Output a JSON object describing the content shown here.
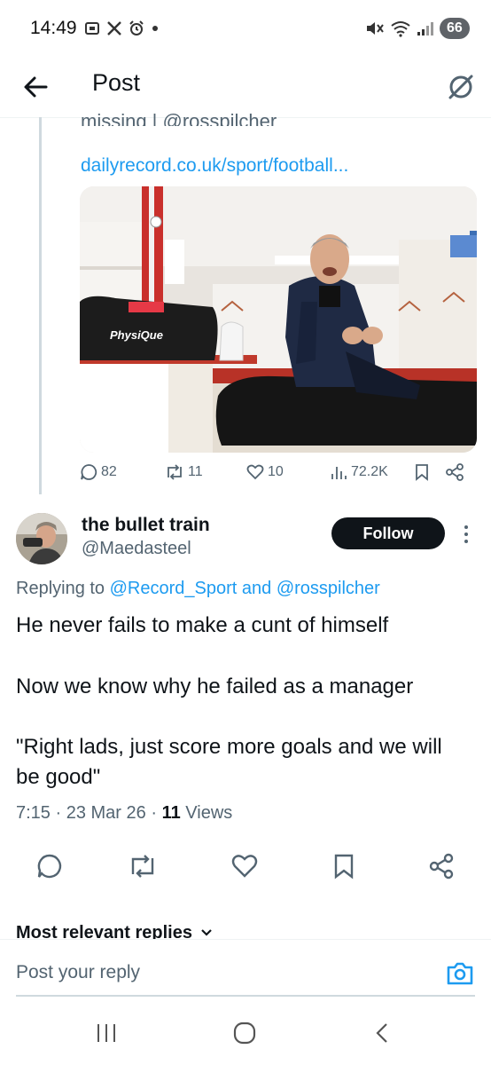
{
  "status_bar": {
    "time": "14:49",
    "battery": "66",
    "icons": [
      "screenshot-icon",
      "x-logo-icon",
      "alarm-icon",
      "dot-icon",
      "mute-icon",
      "wifi-icon",
      "signal-icon"
    ]
  },
  "header": {
    "title": "Post"
  },
  "quoted_post": {
    "cut_text": "missing | @rosspilcher",
    "link": "dailyrecord.co.uk/sport/football...",
    "image_alt": "",
    "bag_text": "PhysiQue",
    "stats": {
      "replies": "82",
      "reposts": "11",
      "likes": "10",
      "views": "72.2K"
    }
  },
  "reply_post": {
    "display_name": "the bullet train",
    "handle": "@Maedasteel",
    "follow_label": "Follow",
    "replying_prefix": "Replying to",
    "replying_to_1": "@Record_Sport",
    "replying_and": "and",
    "replying_to_2": "@rosspilcher",
    "paragraphs": [
      "He never fails to make a cunt of himself",
      "Now we know why he failed as a manager",
      "\"Right lads, just score more goals and we will be good\""
    ],
    "time": "7:15",
    "date": "23 Mar 26",
    "views_count": "11",
    "views_label": "Views"
  },
  "replies_section": {
    "sort_label": "Most relevant replies"
  },
  "reply_bar": {
    "placeholder": "Post your reply"
  },
  "colors": {
    "link": "#1d9bf0",
    "muted": "#536471",
    "text": "#0f1419",
    "follow_bg": "#0f1419"
  }
}
